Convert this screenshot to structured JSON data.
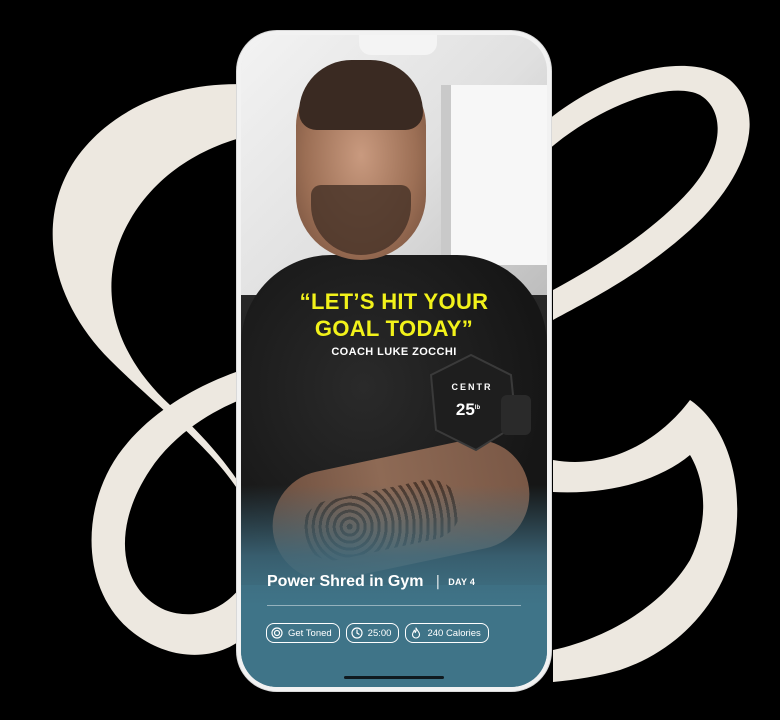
{
  "colors": {
    "background": "#000000",
    "swoosh": "#ede8e0",
    "quote_yellow": "#f2f21a",
    "card_teal": "#3f7488",
    "text_white": "#ffffff"
  },
  "promo": {
    "quote_line1": "“LET’S HIT YOUR",
    "quote_line2": "GOAL TODAY”",
    "coach": "COACH LUKE ZOCCHI"
  },
  "dumbbell": {
    "brand": "CENTR",
    "weight": "25",
    "unit": "lb"
  },
  "workout": {
    "title": "Power Shred in Gym",
    "separator": "|",
    "day": "DAY 4",
    "chips": [
      {
        "icon": "target-icon",
        "label": "Get Toned"
      },
      {
        "icon": "clock-icon",
        "label": "25:00"
      },
      {
        "icon": "flame-icon",
        "label": "240 Calories"
      }
    ]
  }
}
